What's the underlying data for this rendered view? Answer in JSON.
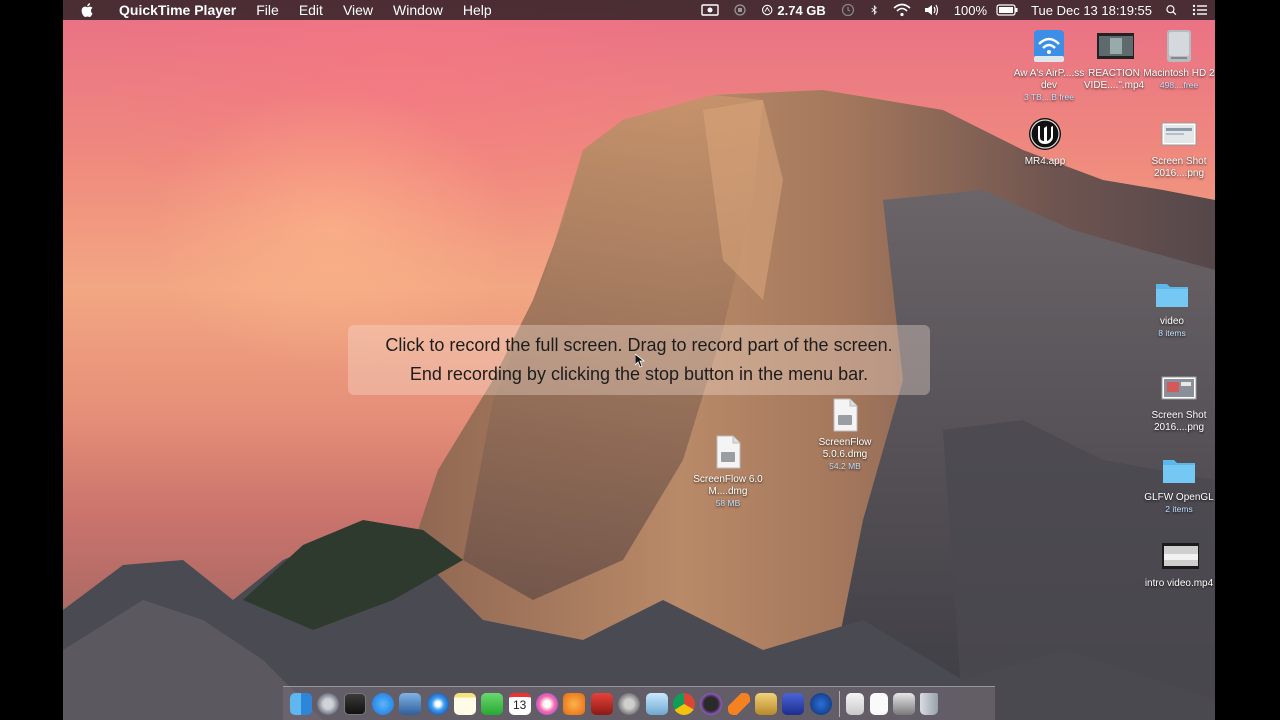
{
  "menubar": {
    "app_name": "QuickTime Player",
    "menus": [
      "File",
      "Edit",
      "View",
      "Window",
      "Help"
    ],
    "memory": "2.74 GB",
    "battery": "100%",
    "datetime": "Tue Dec 13  18:19:55"
  },
  "hint": {
    "line1": "Click to record the full screen. Drag to record part of the screen.",
    "line2": "End recording by clicking the stop button in the menu bar."
  },
  "desktop_icons": [
    {
      "name": "Aw A's AirP....ss dev",
      "sub": "3 TB,...B free",
      "icon": "airport-disk-icon"
    },
    {
      "name": "REACTION VIDE....\".mp4",
      "sub": "",
      "icon": "video-thumbnail-icon"
    },
    {
      "name": "Macintosh HD 2",
      "sub": "498....free",
      "icon": "hard-drive-icon"
    },
    {
      "name": "MR4.app",
      "sub": "",
      "icon": "unreal-app-icon"
    },
    {
      "name": "Screen Shot 2016....png",
      "sub": "",
      "icon": "screenshot-file-icon"
    },
    {
      "name": "video",
      "sub": "8 items",
      "icon": "folder-icon"
    },
    {
      "name": "Screen Shot 2016....png",
      "sub": "",
      "icon": "screenshot-file-icon"
    },
    {
      "name": "GLFW OpenGL",
      "sub": "2 items",
      "icon": "folder-icon"
    },
    {
      "name": "intro video.mp4",
      "sub": "",
      "icon": "video-thumbnail-icon"
    },
    {
      "name": "ScreenFlow 5.0.6.dmg",
      "sub": "54.2 MB",
      "icon": "dmg-file-icon"
    },
    {
      "name": "ScreenFlow 6.0 M....dmg",
      "sub": "58 MB",
      "icon": "dmg-file-icon"
    }
  ],
  "dock": {
    "calendar_day": "13"
  }
}
